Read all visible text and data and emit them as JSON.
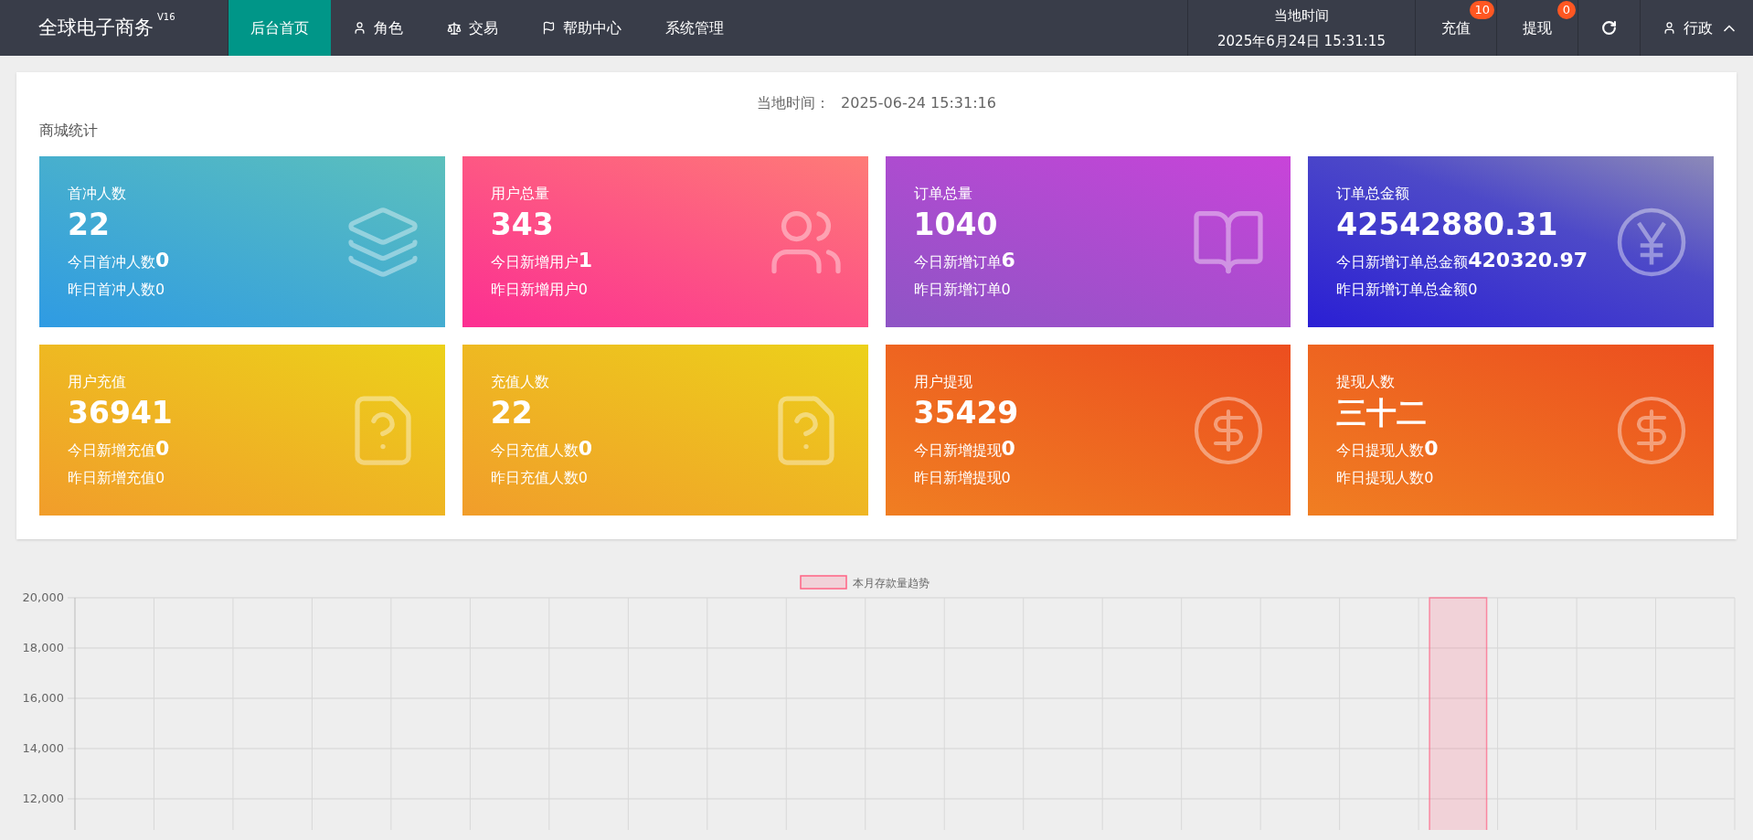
{
  "header": {
    "brand": "全球电子商务",
    "version": "V16",
    "nav": [
      {
        "label": "后台首页",
        "kind": "plain",
        "selected": true
      },
      {
        "label": "角色",
        "kind": "user",
        "selected": false
      },
      {
        "label": "交易",
        "kind": "scale",
        "selected": false
      },
      {
        "label": "帮助中心",
        "kind": "flag",
        "selected": false
      },
      {
        "label": "系统管理",
        "kind": "plain",
        "selected": false
      }
    ],
    "clock_label": "当地时间",
    "clock_value": "2025年6月24日 15:31:15",
    "actions": [
      {
        "label": "充值",
        "badge": "10"
      },
      {
        "label": "提现",
        "badge": "0"
      }
    ],
    "user": "行政"
  },
  "panel": {
    "time_label": "当地时间：",
    "time_value": "2025-06-24 15:31:16",
    "title": "商城统计",
    "cards": [
      {
        "title": "首冲人数",
        "value": "22",
        "today_label": "今日首冲人数",
        "today_value": "0",
        "yesterday": "昨日首冲人数0",
        "kind": "layers",
        "color": "#2f9be3"
      },
      {
        "title": "用户总量",
        "value": "343",
        "today_label": "今日新增用户",
        "today_value": "1",
        "yesterday": "昨日新增用户0",
        "kind": "users",
        "color": "#fc2e92"
      },
      {
        "title": "订单总量",
        "value": "1040",
        "today_label": "今日新增订单",
        "today_value": "6",
        "yesterday": "昨日新增订单0",
        "kind": "book",
        "color": "#8e55c5"
      },
      {
        "title": "订单总金额",
        "value": "42542880.31",
        "today_label": "今日新增订单总金额",
        "today_value": "420320.97",
        "yesterday": "昨日新增订单总金额0",
        "kind": "yen",
        "color": "#2a1fd4"
      },
      {
        "title": "用户充值",
        "value": "36941",
        "today_label": "今日新增充值",
        "today_value": "0",
        "yesterday": "昨日新增充值0",
        "kind": "note",
        "color": "#f19d2b"
      },
      {
        "title": "充值人数",
        "value": "22",
        "today_label": "今日充值人数",
        "today_value": "0",
        "yesterday": "昨日充值人数0",
        "kind": "note",
        "color": "#f19d2b"
      },
      {
        "title": "用户提现",
        "value": "35429",
        "today_label": "今日新增提现",
        "today_value": "0",
        "yesterday": "昨日新增提现0",
        "kind": "dollar",
        "color": "#f07e22"
      },
      {
        "title": "提现人数",
        "value": "三十二",
        "today_label": "今日提现人数",
        "today_value": "0",
        "yesterday": "昨日提现人数0",
        "kind": "dollar",
        "color": "#f07e22"
      }
    ]
  },
  "chart": {
    "chart_data": {
      "type": "bar",
      "ylim": [
        10800,
        20000
      ],
      "grid": true,
      "yticks": [
        {
          "value": 12000,
          "label": "12,000"
        },
        {
          "value": 14000,
          "label": "14,000"
        },
        {
          "value": 16000,
          "label": "16,000"
        },
        {
          "value": 18000,
          "label": "18,000"
        },
        {
          "value": 20000,
          "label": "20,000"
        }
      ],
      "series": [
        {
          "name": "本月存款量趋势",
          "color": "#ff6384",
          "values": [
            null,
            null,
            null,
            null,
            null,
            null,
            null,
            null,
            null,
            null,
            null,
            null,
            null,
            null,
            null,
            null,
            null,
            20000,
            null,
            null,
            null
          ]
        }
      ]
    }
  }
}
